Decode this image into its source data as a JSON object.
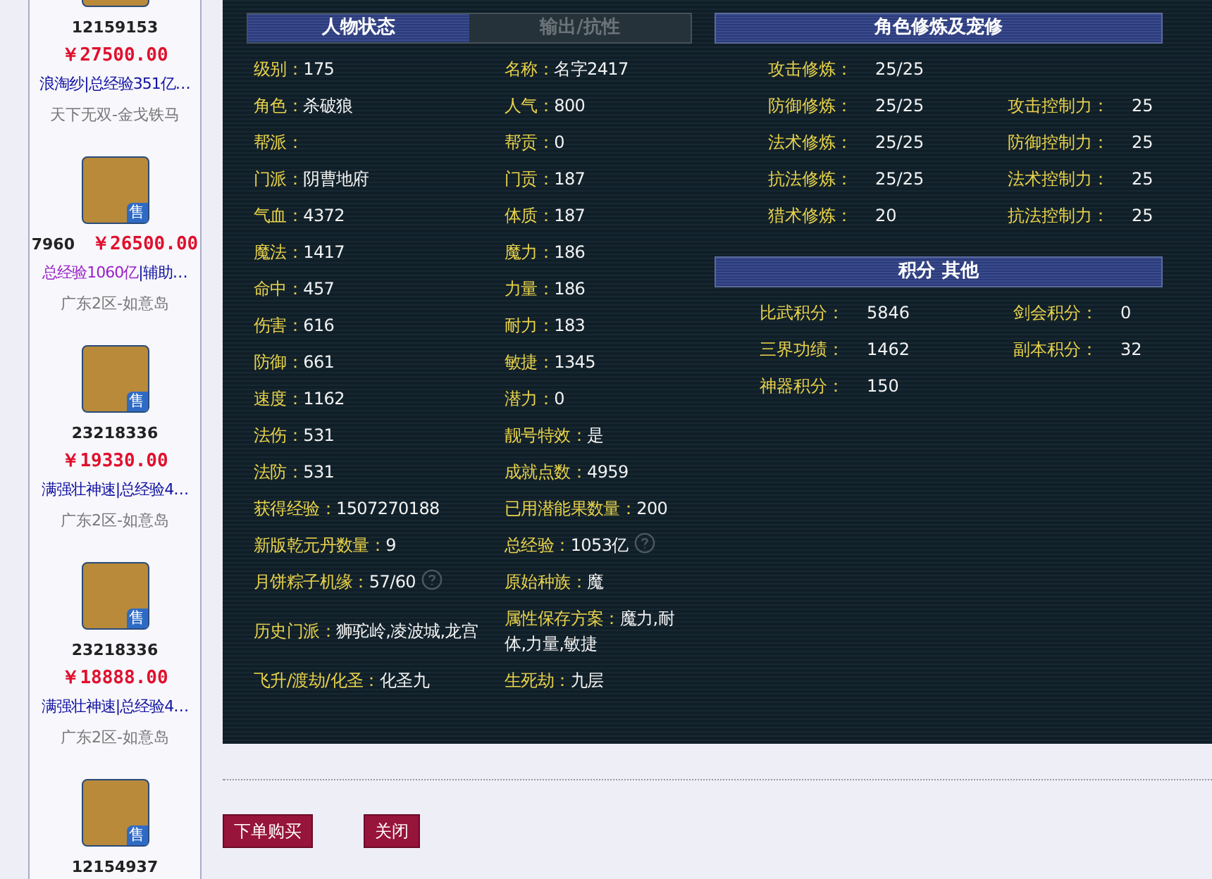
{
  "listings": [
    {
      "id": "12159153",
      "price": "￥27500.00",
      "same_line": false,
      "desc": [
        {
          "text": "浪淘纱|总经验351亿…",
          "kind": "normal"
        }
      ],
      "server": "天下无双-金戈铁马"
    },
    {
      "id": "7960",
      "price": "￥26500.00",
      "same_line": true,
      "badge": "售",
      "desc": [
        {
          "text": "总经验1060亿",
          "kind": "highlight"
        },
        {
          "text": "|辅助…",
          "kind": "normal"
        }
      ],
      "server": "广东2区-如意岛"
    },
    {
      "id": "23218336",
      "price": "￥19330.00",
      "same_line": false,
      "badge": "售",
      "desc": [
        {
          "text": "满强壮神速|总经验4…",
          "kind": "normal"
        }
      ],
      "server": "广东2区-如意岛"
    },
    {
      "id": "23218336",
      "price": "￥18888.00",
      "same_line": false,
      "badge": "售",
      "desc": [
        {
          "text": "满强壮神速|总经验4…",
          "kind": "normal"
        }
      ],
      "server": "广东2区-如意岛"
    },
    {
      "id": "12154937",
      "badge": "售",
      "same_line": false
    }
  ],
  "tabs": [
    {
      "label": "人物状态",
      "selected": true
    },
    {
      "label": "输出/抗性",
      "selected": false
    }
  ],
  "stats": [
    [
      {
        "label": "级别：",
        "value": "175"
      },
      {
        "label": "名称：",
        "value": "名字2417"
      }
    ],
    [
      {
        "label": "角色：",
        "value": "杀破狼"
      },
      {
        "label": "人气：",
        "value": "800"
      }
    ],
    [
      {
        "label": "帮派："
      },
      {
        "label": "帮贡：",
        "value": "0"
      }
    ],
    [
      {
        "label": "门派：",
        "value": "阴曹地府"
      },
      {
        "label": "门贡：",
        "value": "187"
      }
    ],
    [
      {
        "label": "气血：",
        "value": "4372"
      },
      {
        "label": "体质：",
        "value": "187"
      }
    ],
    [
      {
        "label": "魔法：",
        "value": "1417"
      },
      {
        "label": "魔力：",
        "value": "186"
      }
    ],
    [
      {
        "label": "命中：",
        "value": "457"
      },
      {
        "label": "力量：",
        "value": "186"
      }
    ],
    [
      {
        "label": "伤害：",
        "value": "616"
      },
      {
        "label": "耐力：",
        "value": "183"
      }
    ],
    [
      {
        "label": "防御：",
        "value": "661"
      },
      {
        "label": "敏捷：",
        "value": "1345"
      }
    ],
    [
      {
        "label": "速度：",
        "value": "1162"
      },
      {
        "label": "潜力：",
        "value": "0"
      }
    ],
    [
      {
        "label": "法伤：",
        "value": "531"
      },
      {
        "label": "靓号特效：",
        "value": "是"
      }
    ],
    [
      {
        "label": "法防：",
        "value": "531"
      },
      {
        "label": "成就点数：",
        "value": "4959"
      }
    ],
    [
      {
        "label": "获得经验：",
        "value": "1507270188"
      },
      {
        "label": "已用潜能果数量：",
        "value": "200"
      }
    ],
    [
      {
        "label": "新版乾元丹数量：",
        "value": "9"
      },
      {
        "label": "总经验：",
        "value": "1053亿",
        "help": true
      }
    ],
    [
      {
        "label": "月饼粽子机缘：",
        "value": "57/60",
        "help": true
      },
      {
        "label": "原始种族：",
        "value": "魔"
      }
    ],
    [
      {
        "label": "历史门派：",
        "value": "狮驼岭,凌波城,龙宫"
      },
      {
        "label": "属性保存方案：",
        "value": "魔力,耐体,力量,敏捷"
      }
    ],
    [
      {
        "label": "飞升/渡劫/化圣：",
        "value": "化圣九"
      },
      {
        "label": "生死劫：",
        "value": "九层"
      }
    ]
  ],
  "cultivation": {
    "title": "角色修炼及宠修",
    "rows": [
      [
        {
          "label": "攻击修炼：",
          "value": "25/25"
        },
        null
      ],
      [
        {
          "label": "防御修炼：",
          "value": "25/25"
        },
        {
          "label": "攻击控制力：",
          "value": "25"
        }
      ],
      [
        {
          "label": "法术修炼：",
          "value": "25/25"
        },
        {
          "label": "防御控制力：",
          "value": "25"
        }
      ],
      [
        {
          "label": "抗法修炼：",
          "value": "25/25"
        },
        {
          "label": "法术控制力：",
          "value": "25"
        }
      ],
      [
        {
          "label": "猎术修炼：",
          "value": "20"
        },
        {
          "label": "抗法控制力：",
          "value": "25"
        }
      ]
    ]
  },
  "points": {
    "title": "积分 其他",
    "rows": [
      [
        {
          "label": "比武积分：",
          "value": "5846"
        },
        {
          "label": "剑会积分：",
          "value": "0"
        }
      ],
      [
        {
          "label": "三界功绩：",
          "value": "1462"
        },
        {
          "label": "副本积分：",
          "value": "32"
        }
      ],
      [
        {
          "label": "神器积分：",
          "value": "150"
        },
        null
      ]
    ]
  },
  "buttons": [
    "下单购买",
    "关闭"
  ]
}
